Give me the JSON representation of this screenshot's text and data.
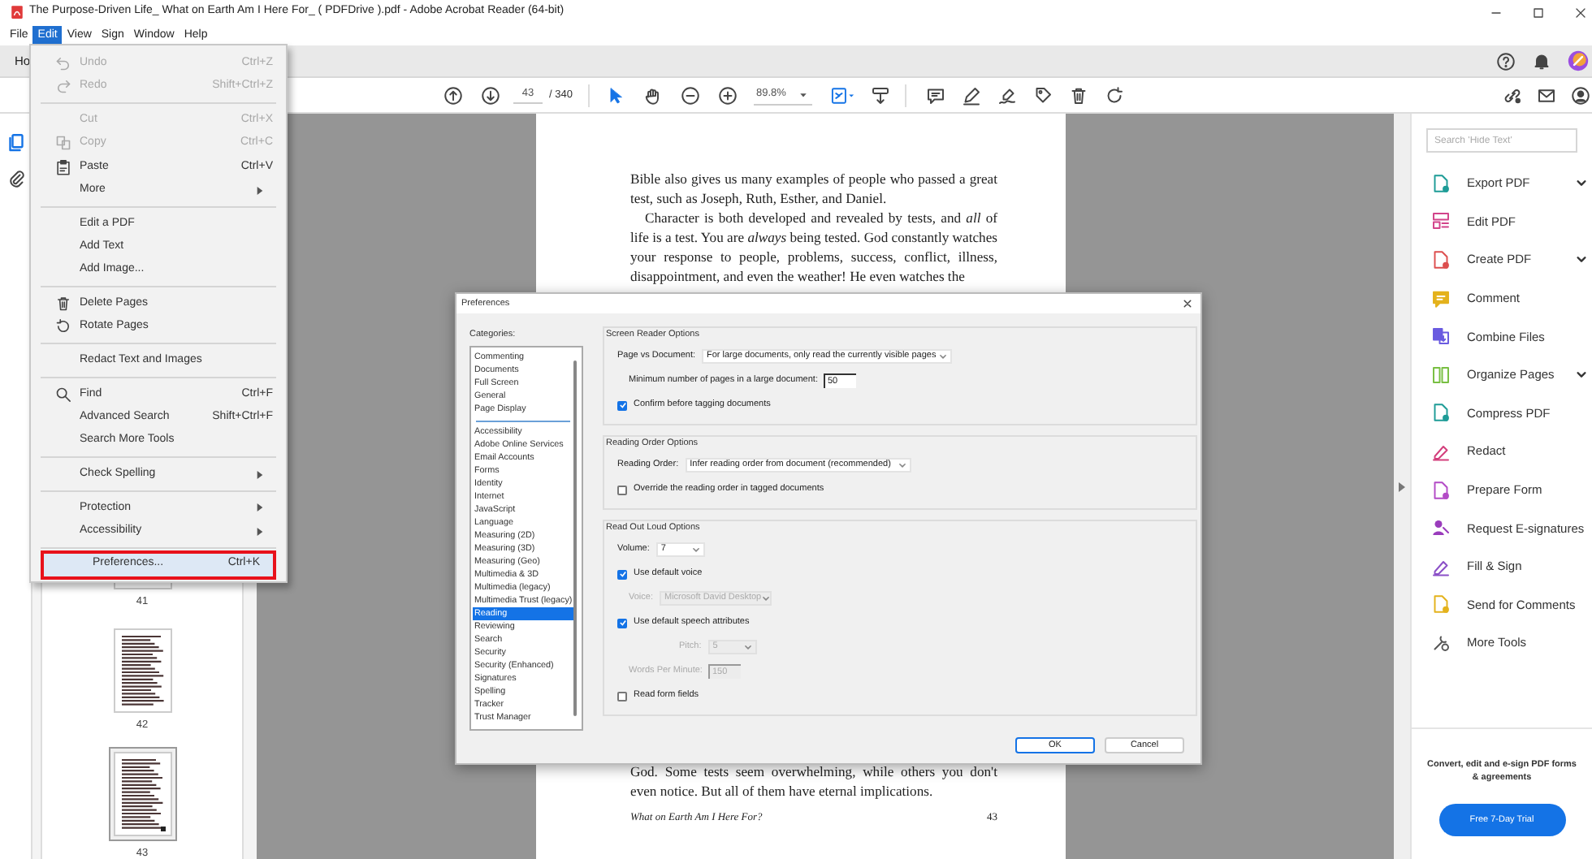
{
  "window": {
    "title": "The Purpose-Driven Life_ What on Earth Am I Here For_ ( PDFDrive ).pdf - Adobe Acrobat Reader (64-bit)"
  },
  "menu_bar": [
    {
      "label": "File",
      "selected": false
    },
    {
      "label": "Edit",
      "selected": true
    },
    {
      "label": "View",
      "selected": false
    },
    {
      "label": "Sign",
      "selected": false
    },
    {
      "label": "Window",
      "selected": false
    },
    {
      "label": "Help",
      "selected": false
    }
  ],
  "tabs": [
    {
      "label": "Ho",
      "selected": true
    }
  ],
  "toolbar": {
    "page": "43",
    "page_count": "/ 340",
    "zoom": "89.8%"
  },
  "edit_menu": {
    "groups": [
      {
        "items": [
          {
            "label": "Undo",
            "shortcut": "Ctrl+Z",
            "disabled": true,
            "submenu": false,
            "selected": false
          },
          {
            "label": "Redo",
            "shortcut": "Shift+Ctrl+Z",
            "disabled": true,
            "submenu": false,
            "selected": false
          }
        ]
      },
      {
        "items": [
          {
            "label": "Cut",
            "shortcut": "Ctrl+X",
            "disabled": true,
            "submenu": false,
            "selected": false
          },
          {
            "label": "Copy",
            "shortcut": "Ctrl+C",
            "disabled": true,
            "submenu": false,
            "selected": false
          },
          {
            "label": "Paste",
            "shortcut": "Ctrl+V",
            "disabled": false,
            "submenu": false,
            "selected": false
          },
          {
            "label": "More",
            "disabled": false,
            "submenu": true,
            "selected": false
          }
        ]
      },
      {
        "items": [
          {
            "label": "Edit a PDF",
            "disabled": false,
            "submenu": false,
            "selected": false
          },
          {
            "label": "Add Text",
            "disabled": false,
            "submenu": false,
            "selected": false
          },
          {
            "label": "Add Image...",
            "disabled": false,
            "submenu": false,
            "selected": false
          }
        ]
      },
      {
        "items": [
          {
            "label": "Delete Pages",
            "disabled": false,
            "submenu": false,
            "selected": false
          },
          {
            "label": "Rotate Pages",
            "disabled": false,
            "submenu": false,
            "selected": false
          }
        ]
      },
      {
        "items": [
          {
            "label": "Redact Text and Images",
            "disabled": false,
            "submenu": false,
            "selected": false
          }
        ]
      },
      {
        "items": [
          {
            "label": "Find",
            "shortcut": "Ctrl+F",
            "disabled": false,
            "submenu": false,
            "selected": false
          },
          {
            "label": "Advanced Search",
            "shortcut": "Shift+Ctrl+F",
            "disabled": false,
            "submenu": false,
            "selected": false
          },
          {
            "label": "Search More Tools",
            "disabled": false,
            "submenu": false,
            "selected": false
          }
        ]
      },
      {
        "items": [
          {
            "label": "Check Spelling",
            "disabled": false,
            "submenu": true,
            "selected": false
          }
        ]
      },
      {
        "items": [
          {
            "label": "Protection",
            "disabled": false,
            "submenu": true,
            "selected": false
          },
          {
            "label": "Accessibility",
            "disabled": false,
            "submenu": true,
            "selected": false
          }
        ]
      },
      {
        "items": [
          {
            "label": "Preferences...",
            "shortcut": "Ctrl+K",
            "disabled": false,
            "submenu": false,
            "selected": true
          }
        ]
      }
    ]
  },
  "thumbnails": [
    {
      "label": "41",
      "selected": false
    },
    {
      "label": "42",
      "selected": false
    },
    {
      "label": "43",
      "selected": true
    }
  ],
  "document": {
    "top_paragraphs": [
      {
        "text": "Bible also gives us many examples of people who passed a great test, such as Joseph, Ruth, Esther, and Daniel.",
        "indent": false
      },
      {
        "text": "Character is both developed and revealed by tests, and *all* of life is a test. You are *always* being tested. God constantly watches your response to people, problems, success, conflict, illness, disappointment, and even the weather! He even watches the",
        "indent": true
      }
    ],
    "bottom_paragraph": "God. Some tests seem overwhelming, while others you don't even notice. But all of them have eternal implications.",
    "footer_title": "What on Earth Am I Here For?",
    "footer_page": "43"
  },
  "preferences_dialog": {
    "title": "Preferences",
    "categories_label": "Categories:",
    "category_groups": [
      {
        "items": [
          {
            "label": "Commenting",
            "selected": false
          },
          {
            "label": "Documents",
            "selected": false
          },
          {
            "label": "Full Screen",
            "selected": false
          },
          {
            "label": "General",
            "selected": false
          },
          {
            "label": "Page Display",
            "selected": false
          }
        ]
      },
      {
        "items": [
          {
            "label": "Accessibility",
            "selected": false
          },
          {
            "label": "Adobe Online Services",
            "selected": false
          },
          {
            "label": "Email Accounts",
            "selected": false
          },
          {
            "label": "Forms",
            "selected": false
          },
          {
            "label": "Identity",
            "selected": false
          },
          {
            "label": "Internet",
            "selected": false
          },
          {
            "label": "JavaScript",
            "selected": false
          },
          {
            "label": "Language",
            "selected": false
          },
          {
            "label": "Measuring (2D)",
            "selected": false
          },
          {
            "label": "Measuring (3D)",
            "selected": false
          },
          {
            "label": "Measuring (Geo)",
            "selected": false
          },
          {
            "label": "Multimedia & 3D",
            "selected": false
          },
          {
            "label": "Multimedia (legacy)",
            "selected": false
          },
          {
            "label": "Multimedia Trust (legacy)",
            "selected": false
          },
          {
            "label": "Reading",
            "selected": true
          },
          {
            "label": "Reviewing",
            "selected": false
          },
          {
            "label": "Search",
            "selected": false
          },
          {
            "label": "Security",
            "selected": false
          },
          {
            "label": "Security (Enhanced)",
            "selected": false
          },
          {
            "label": "Signatures",
            "selected": false
          },
          {
            "label": "Spelling",
            "selected": false
          },
          {
            "label": "Tracker",
            "selected": false
          },
          {
            "label": "Trust Manager",
            "selected": false
          }
        ]
      }
    ],
    "sections": [
      {
        "title": "Screen Reader Options",
        "rows": [
          {
            "kind": "dropdown",
            "label": "Page vs Document:",
            "value": "For large documents, only read the currently visible pages",
            "disabled": false
          },
          {
            "kind": "number",
            "label": "Minimum number of pages in a large document:",
            "value": "50",
            "disabled": false
          },
          {
            "kind": "checkbox",
            "label": "Confirm before tagging documents",
            "checked": true,
            "disabled": false
          }
        ]
      },
      {
        "title": "Reading Order Options",
        "rows": [
          {
            "kind": "dropdown",
            "label": "Reading Order:",
            "value": "Infer reading order from document (recommended)",
            "disabled": false
          },
          {
            "kind": "checkbox",
            "label": "Override the reading order in tagged documents",
            "checked": false,
            "disabled": false
          }
        ]
      },
      {
        "title": "Read Out Loud Options",
        "rows": [
          {
            "kind": "dropdown",
            "label": "Volume:",
            "value": "7",
            "disabled": false
          },
          {
            "kind": "checkbox",
            "label": "Use default voice",
            "checked": true,
            "disabled": false
          },
          {
            "kind": "dropdown",
            "label": "Voice:",
            "value": "Microsoft David Desktop",
            "disabled": true
          },
          {
            "kind": "checkbox",
            "label": "Use default speech attributes",
            "checked": true,
            "disabled": false
          },
          {
            "kind": "dropdown",
            "label": "Pitch:",
            "value": "5",
            "disabled": true
          },
          {
            "kind": "number",
            "label": "Words Per Minute:",
            "value": "150",
            "disabled": true
          },
          {
            "kind": "checkbox",
            "label": "Read form fields",
            "checked": false,
            "disabled": false
          }
        ]
      }
    ],
    "buttons": [
      "OK",
      "Cancel"
    ]
  },
  "tools_panel": {
    "search_placeholder": "Search 'Hide Text'",
    "tools": [
      {
        "label": "Export PDF",
        "color": "#1e9c97",
        "has_menu": true
      },
      {
        "label": "Edit PDF",
        "color": "#d2438a",
        "has_menu": false
      },
      {
        "label": "Create PDF",
        "color": "#dd4f4f",
        "has_menu": true
      },
      {
        "label": "Comment",
        "color": "#e4b21c",
        "has_menu": false
      },
      {
        "label": "Combine Files",
        "color": "#6a5be0",
        "has_menu": false
      },
      {
        "label": "Organize Pages",
        "color": "#78bf42",
        "has_menu": true
      },
      {
        "label": "Compress PDF",
        "color": "#1e9c97",
        "has_menu": false
      },
      {
        "label": "Redact",
        "color": "#d33f7c",
        "has_menu": false
      },
      {
        "label": "Prepare Form",
        "color": "#b34bc6",
        "has_menu": false
      },
      {
        "label": "Request E-signatures",
        "color": "#9a3cbc",
        "has_menu": false
      },
      {
        "label": "Fill & Sign",
        "color": "#8b50c7",
        "has_menu": false
      },
      {
        "label": "Send for Comments",
        "color": "#e4b21c",
        "has_menu": false
      },
      {
        "label": "More Tools",
        "color": "#555555",
        "has_menu": false
      }
    ],
    "promo_text": "Convert, edit and e-sign PDF forms & agreements",
    "promo_button": "Free 7-Day Trial"
  }
}
